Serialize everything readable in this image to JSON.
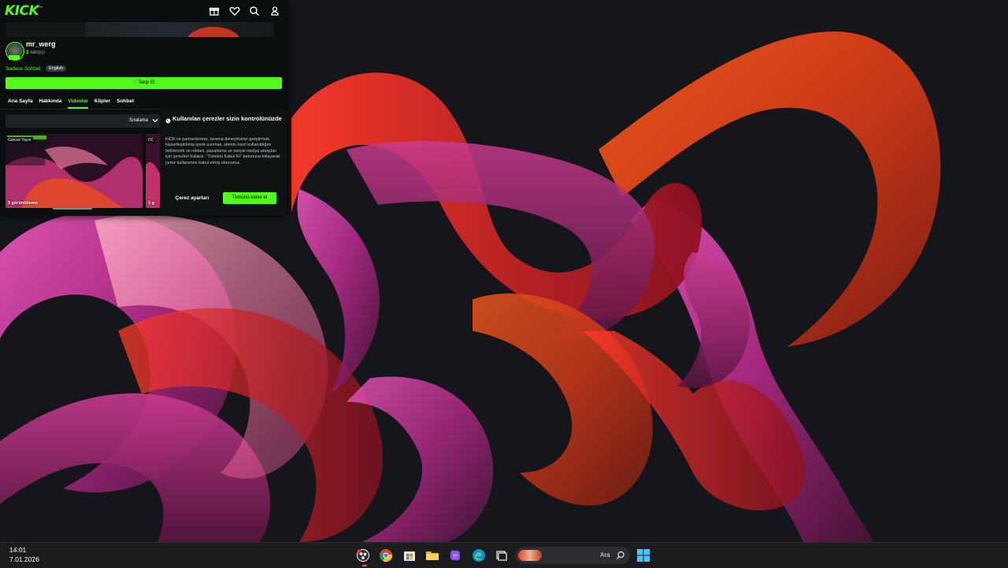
{
  "browser": {
    "logo": "KICK",
    "logo_suffix": "beta",
    "nav_icons": [
      "gift-icon",
      "heart-icon",
      "search-icon",
      "user-icon"
    ],
    "channel": {
      "username": "mr_werg",
      "followers_count": "2",
      "followers_label": "takipçi",
      "chat_mode": "Sadece Sohbet",
      "language": "English",
      "follow_button": "Takip Et"
    },
    "tabs": [
      {
        "label": "Ana Sayfa",
        "active": false
      },
      {
        "label": "Hakkında",
        "active": false
      },
      {
        "label": "Videolar",
        "active": true
      },
      {
        "label": "Klipler",
        "active": false
      },
      {
        "label": "Sohbet",
        "active": false
      }
    ],
    "sort_label": "Sıralama",
    "videos": [
      {
        "tag": "Güncel Yayın",
        "views": "9 görüntüleme"
      },
      {
        "tag": "DC",
        "views": "3 g"
      }
    ],
    "cookie_dialog": {
      "title": "Kullanılan çerezler sizin kontrolünüzde",
      "body": "KICK ve partnerlerimiz, tarama deneyiminizi geliştirmek, kişiselleştirilmiş içerik sunmak, sitenin nasıl kullanıldığını belirlemek ve reklam, pazarlama ve sosyal medya amaçları için çerezleri kullanır. \"Tümünü Kabul Et\" butonuna tıklayarak çerez kullanımını kabul etmiş olursunuz.",
      "settings_button": "Çerez ayarları",
      "accept_button": "Tümünü kabul et"
    }
  },
  "taskbar": {
    "time": "14:01",
    "date": "7.01.2026",
    "search_label": "Ara",
    "apps": [
      "obs-icon",
      "chrome-icon",
      "store-icon",
      "file-explorer-icon",
      "copilot-icon",
      "edge-icon",
      "task-view-icon",
      "windows-start-icon"
    ]
  },
  "colors": {
    "kick_green": "#53fc18",
    "panel_bg": "#0b0e0f",
    "taskbar_bg": "#1c1c1f"
  }
}
